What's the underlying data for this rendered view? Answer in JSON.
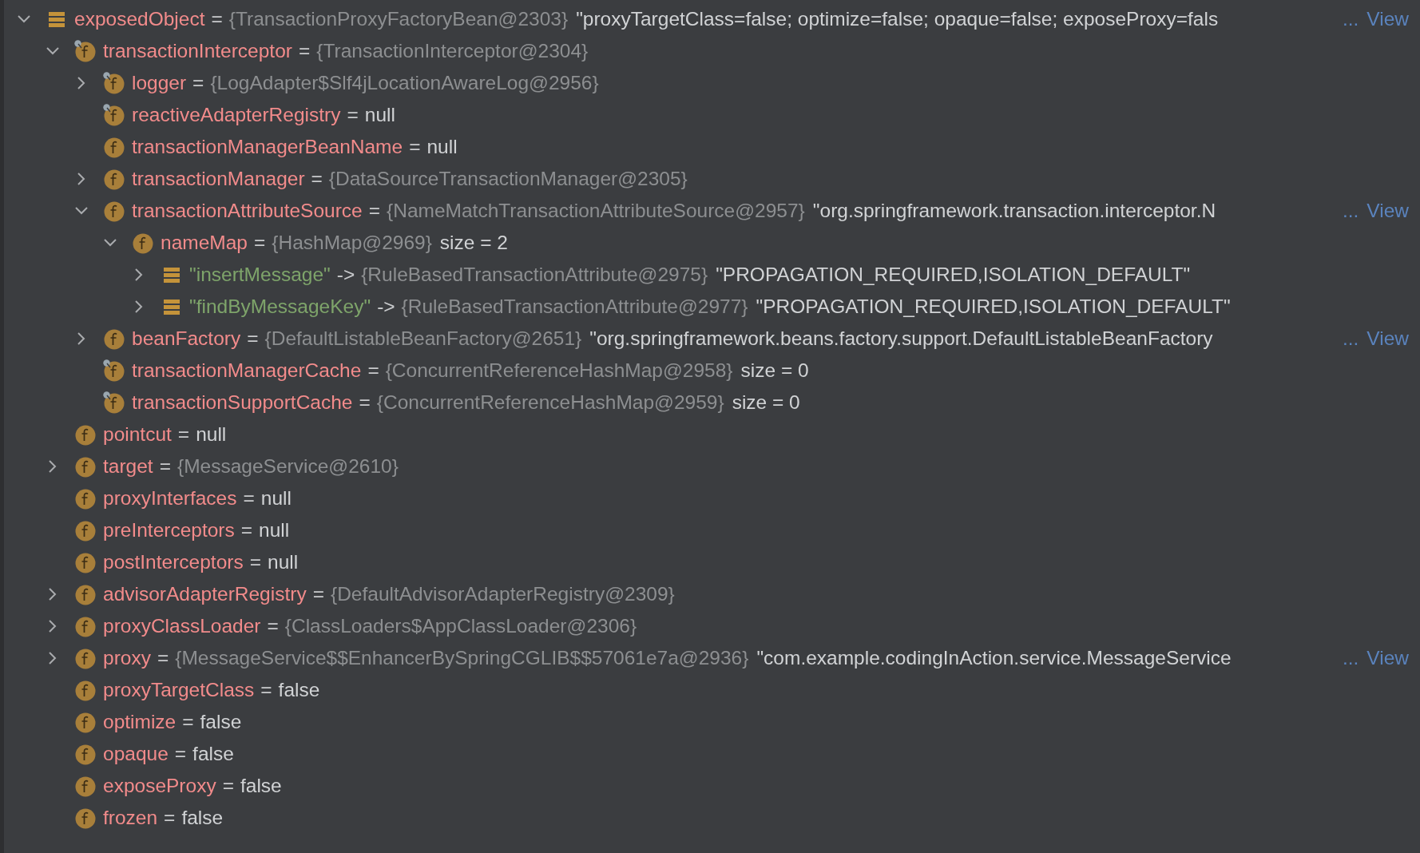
{
  "tree": [
    {
      "kind": "variable",
      "name": "exposedObject",
      "op": "=",
      "type": "{TransactionProxyFactoryBean@2303}",
      "value": "\"proxyTargetClass=false; optimize=false; opaque=false; exposeProxy=fals",
      "more": "...",
      "link": "View",
      "expanded": true,
      "static": false,
      "children": [
        {
          "kind": "field",
          "name": "transactionInterceptor",
          "op": "=",
          "type": "{TransactionInterceptor@2304}",
          "expanded": true,
          "static": true,
          "children": [
            {
              "kind": "field",
              "name": "logger",
              "op": "=",
              "type": "{LogAdapter$Slf4jLocationAwareLog@2956}",
              "expanded": false,
              "static": true
            },
            {
              "kind": "field",
              "name": "reactiveAdapterRegistry",
              "op": "=",
              "value": "null",
              "static": true
            },
            {
              "kind": "field",
              "name": "transactionManagerBeanName",
              "op": "=",
              "value": "null",
              "static": false
            },
            {
              "kind": "field",
              "name": "transactionManager",
              "op": "=",
              "type": "{DataSourceTransactionManager@2305}",
              "expanded": false,
              "static": false
            },
            {
              "kind": "field",
              "name": "transactionAttributeSource",
              "op": "=",
              "type": "{NameMatchTransactionAttributeSource@2957}",
              "value": "\"org.springframework.transaction.interceptor.N",
              "more": "...",
              "link": "View",
              "expanded": true,
              "static": false,
              "children": [
                {
                  "kind": "field",
                  "name": "nameMap",
                  "op": "=",
                  "type": "{HashMap@2969}",
                  "value": "size = 2",
                  "expanded": true,
                  "static": false,
                  "children": [
                    {
                      "kind": "map_entry",
                      "name": "\"insertMessage\"",
                      "op": "->",
                      "type": "{RuleBasedTransactionAttribute@2975}",
                      "value": "\"PROPAGATION_REQUIRED,ISOLATION_DEFAULT\"",
                      "expanded": false,
                      "static": false
                    },
                    {
                      "kind": "map_entry",
                      "name": "\"findByMessageKey\"",
                      "op": "->",
                      "type": "{RuleBasedTransactionAttribute@2977}",
                      "value": "\"PROPAGATION_REQUIRED,ISOLATION_DEFAULT\"",
                      "expanded": false,
                      "static": false
                    }
                  ]
                }
              ]
            },
            {
              "kind": "field",
              "name": "beanFactory",
              "op": "=",
              "type": "{DefaultListableBeanFactory@2651}",
              "value": "\"org.springframework.beans.factory.support.DefaultListableBeanFactory",
              "more": "...",
              "link": "View",
              "expanded": false,
              "static": false
            },
            {
              "kind": "field",
              "name": "transactionManagerCache",
              "op": "=",
              "type": "{ConcurrentReferenceHashMap@2958}",
              "value": "size = 0",
              "static": true
            },
            {
              "kind": "field",
              "name": "transactionSupportCache",
              "op": "=",
              "type": "{ConcurrentReferenceHashMap@2959}",
              "value": "size = 0",
              "static": true
            }
          ]
        },
        {
          "kind": "field",
          "name": "pointcut",
          "op": "=",
          "value": "null",
          "static": false
        },
        {
          "kind": "field",
          "name": "target",
          "op": "=",
          "type": "{MessageService@2610}",
          "expanded": false,
          "static": false
        },
        {
          "kind": "field",
          "name": "proxyInterfaces",
          "op": "=",
          "value": "null",
          "static": false
        },
        {
          "kind": "field",
          "name": "preInterceptors",
          "op": "=",
          "value": "null",
          "static": false
        },
        {
          "kind": "field",
          "name": "postInterceptors",
          "op": "=",
          "value": "null",
          "static": false
        },
        {
          "kind": "field",
          "name": "advisorAdapterRegistry",
          "op": "=",
          "type": "{DefaultAdvisorAdapterRegistry@2309}",
          "expanded": false,
          "static": false
        },
        {
          "kind": "field",
          "name": "proxyClassLoader",
          "op": "=",
          "type": "{ClassLoaders$AppClassLoader@2306}",
          "expanded": false,
          "static": false
        },
        {
          "kind": "field",
          "name": "proxy",
          "op": "=",
          "type": "{MessageService$$EnhancerBySpringCGLIB$$57061e7a@2936}",
          "value": "\"com.example.codingInAction.service.MessageService",
          "more": "...",
          "link": "View",
          "expanded": false,
          "static": false
        },
        {
          "kind": "field",
          "name": "proxyTargetClass",
          "op": "=",
          "value": "false",
          "static": false
        },
        {
          "kind": "field",
          "name": "optimize",
          "op": "=",
          "value": "false",
          "static": false
        },
        {
          "kind": "field",
          "name": "opaque",
          "op": "=",
          "value": "false",
          "static": false
        },
        {
          "kind": "field",
          "name": "exposeProxy",
          "op": "=",
          "value": "false",
          "static": false
        },
        {
          "kind": "field",
          "name": "frozen",
          "op": "=",
          "value": "false",
          "static": false
        }
      ]
    }
  ]
}
